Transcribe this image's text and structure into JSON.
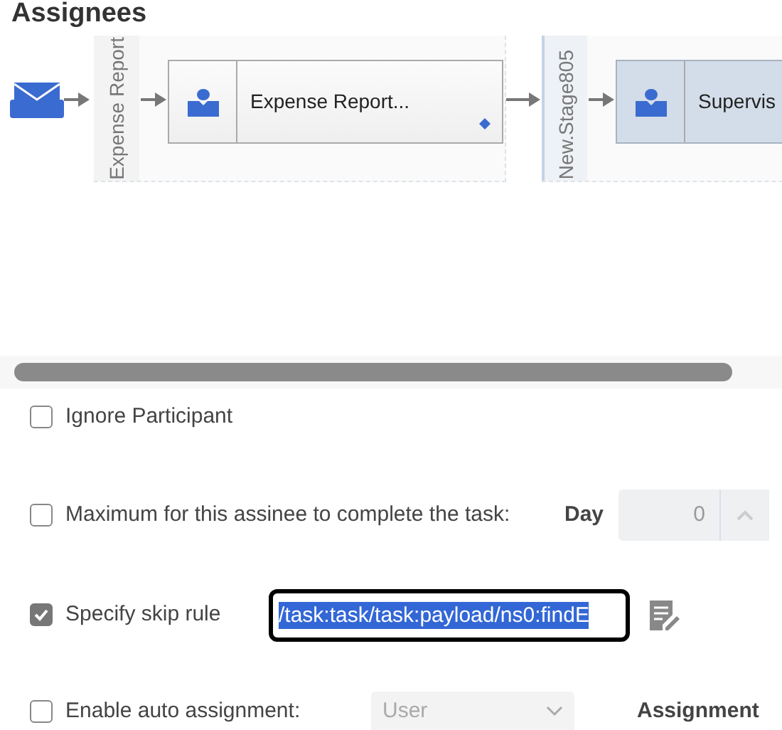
{
  "title": "Assignees",
  "diagram": {
    "lanes": [
      {
        "label": "Expense Report",
        "selected": false,
        "task": {
          "label": "Expense Report...",
          "selected": false,
          "has_marker": true
        }
      },
      {
        "label": "New.Stage805",
        "selected": true,
        "task": {
          "label": "Supervis",
          "selected": true,
          "has_marker": false
        }
      }
    ]
  },
  "options": [
    {
      "kind": "checkbox",
      "label": "Ignore Participant",
      "checked": false
    },
    {
      "kind": "duration",
      "label": "Maximum for this assinee to complete the task:",
      "checked": false,
      "unit": "Day",
      "value": "0"
    },
    {
      "kind": "skip_rule",
      "label": "Specify skip rule",
      "checked": true,
      "value": "/task:task/task:payload/ns0:findE"
    },
    {
      "kind": "auto_assignment",
      "label": "Enable auto assignment:",
      "checked": false,
      "select": "User",
      "extra_label": "Assignment"
    }
  ]
}
